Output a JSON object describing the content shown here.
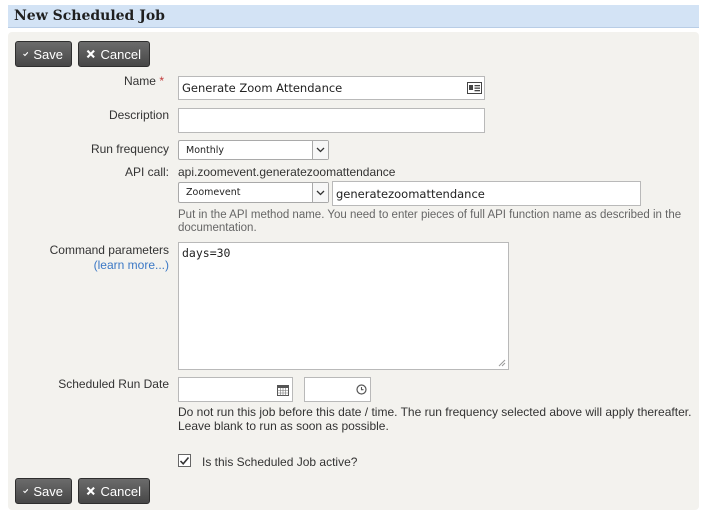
{
  "page": {
    "title": "New Scheduled Job"
  },
  "toolbar": {
    "save_label": "Save",
    "cancel_label": "Cancel"
  },
  "form": {
    "name": {
      "label": "Name",
      "required_mark": "*",
      "value": "Generate Zoom Attendance",
      "icon": "contact-card-icon"
    },
    "description": {
      "label": "Description",
      "value": ""
    },
    "run_frequency": {
      "label": "Run frequency",
      "selected": "Monthly"
    },
    "api_call": {
      "label": "API call:",
      "value_text": "api.zoomevent.generatezoomattendance",
      "entity_selected": "Zoomevent",
      "method_value": "generatezoomattendance",
      "help": "Put in the API method name. You need to enter pieces of full API function name as described in the documentation."
    },
    "command_parameters": {
      "label": "Command parameters",
      "learn_more": "(learn more...)",
      "value": "days=30"
    },
    "scheduled_run_date": {
      "label": "Scheduled Run Date",
      "date_value": "",
      "time_value": "",
      "help_line1": "Do not run this job before this date / time. The run frequency selected above will apply thereafter.",
      "help_line2": "Leave blank to run as soon as possible."
    },
    "active": {
      "label": "Is this Scheduled Job active?",
      "checked": true
    }
  }
}
